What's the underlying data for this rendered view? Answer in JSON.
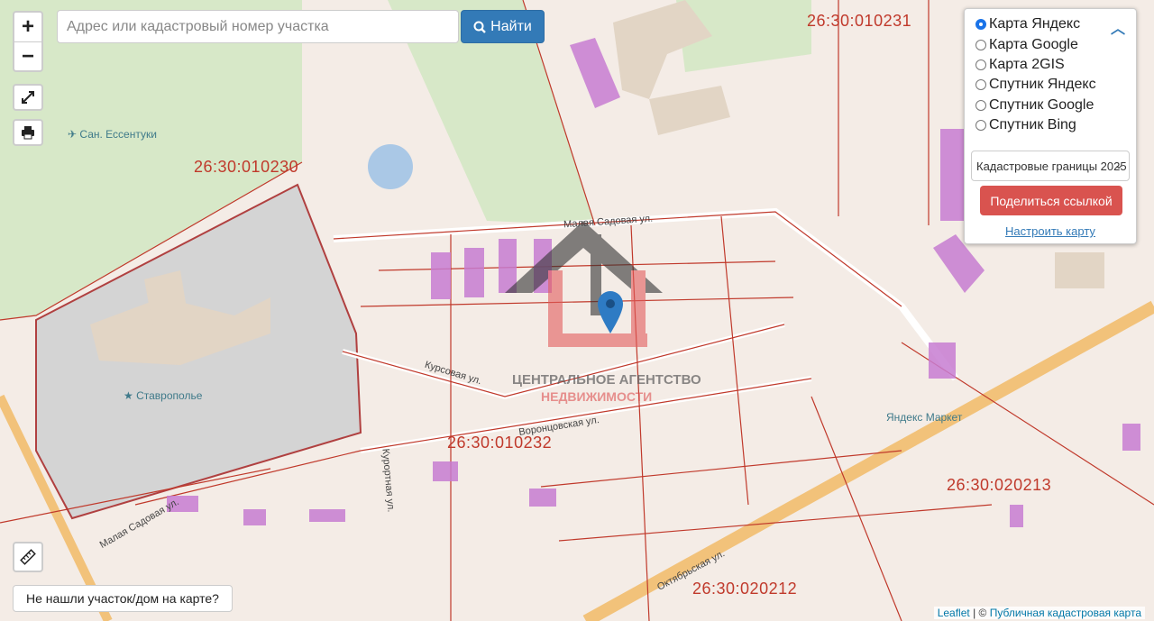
{
  "search": {
    "placeholder": "Адрес или кадастровый номер участка",
    "button_label": "Найти"
  },
  "zoom": {
    "plus": "+",
    "minus": "−"
  },
  "layers": {
    "items": [
      {
        "label": "Карта Яндекс",
        "selected": true
      },
      {
        "label": "Карта Google",
        "selected": false
      },
      {
        "label": "Карта 2GIS",
        "selected": false
      },
      {
        "label": "Спутник Яндекс",
        "selected": false
      },
      {
        "label": "Спутник Google",
        "selected": false
      },
      {
        "label": "Спутник Bing",
        "selected": false
      }
    ],
    "overlay_select": "Кадастровые границы 2025",
    "share_label": "Поделиться ссылкой",
    "setup_link": "Настроить карту"
  },
  "not_found_label": "Не нашли участок/дом на карте?",
  "cadastral_labels": [
    "26:30:010231",
    "26:30:010230",
    "26:30:010232",
    "26:30:020213",
    "26:30:020212"
  ],
  "poi": {
    "san": "Сан. Ессентуки",
    "stavropolye": "Ставрополье",
    "market": "Яндекс Маркет"
  },
  "streets": {
    "malaya_sadovaya": "Малая Садовая ул.",
    "kursovaya": "Курсовая ул.",
    "vorontsovskaya": "Воронцовская ул.",
    "kurortnaya": "Курортная ул.",
    "oktyabrskaya": "Октябрьская ул."
  },
  "watermark": {
    "line1": "ЦЕНТРАЛЬНОЕ АГЕНТСТВО",
    "line2": "НЕДВИЖИМОСТИ"
  },
  "attribution": {
    "leaflet": "Leaflet",
    "sep": "| ©",
    "source": "Публичная кадастровая карта"
  },
  "colors": {
    "accent": "#337ab7",
    "danger": "#d9534f",
    "boundary": "#c0392b",
    "building": "#c77dd1"
  }
}
